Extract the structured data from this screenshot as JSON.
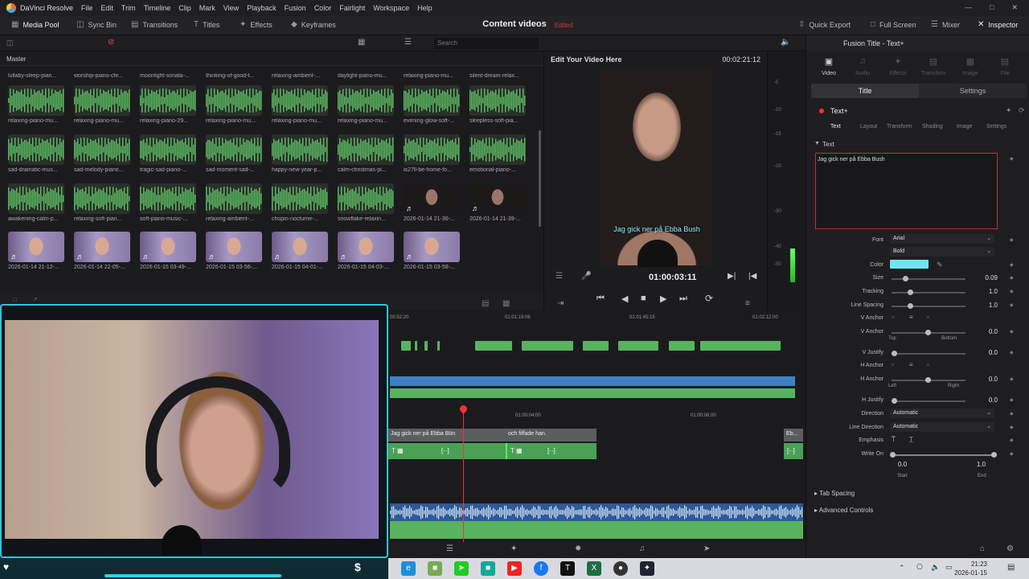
{
  "app": {
    "name": "DaVinci Resolve",
    "menu": [
      "File",
      "Edit",
      "Trim",
      "Timeline",
      "Clip",
      "Mark",
      "View",
      "Playback",
      "Fusion",
      "Color",
      "Fairlight",
      "Workspace",
      "Help"
    ]
  },
  "toolbar": {
    "media_pool": "Media Pool",
    "sync_bin": "Sync Bin",
    "transitions": "Transitions",
    "titles": "Titles",
    "effects": "Effects",
    "keyframes": "Keyframes",
    "project_title": "Content videos",
    "project_status": "Edited",
    "quick_export": "Quick Export",
    "full_screen": "Full Screen",
    "mixer": "Mixer",
    "inspector": "Inspector"
  },
  "search": {
    "placeholder": "Search"
  },
  "media_pool": {
    "bin": "Master",
    "top_labels": [
      "lullaby-sleep-pian...",
      "worship-piano-chr...",
      "moonlight-sonata-...",
      "thinking-of-good-t...",
      "relaxing-ambient-...",
      "daylight-piano-mu...",
      "relaxing-piano-mu...",
      "silent-dream-relax..."
    ],
    "rows": [
      [
        {
          "label": "relaxing-piano-mu...",
          "kind": "audio"
        },
        {
          "label": "relaxing-piano-mu...",
          "kind": "audio"
        },
        {
          "label": "relaxing-piano-29...",
          "kind": "audio"
        },
        {
          "label": "relaxing-piano-mu...",
          "kind": "audio"
        },
        {
          "label": "relaxing-piano-mu...",
          "kind": "audio"
        },
        {
          "label": "relaxing-piano-mu...",
          "kind": "audio"
        },
        {
          "label": "evening-glow-soft-...",
          "kind": "audio"
        },
        {
          "label": "sleepless-soft-pia...",
          "kind": "audio"
        }
      ],
      [
        {
          "label": "sad-dramatic-mus...",
          "kind": "audio"
        },
        {
          "label": "sad-melody-piano...",
          "kind": "audio"
        },
        {
          "label": "tragic-sad-piano-...",
          "kind": "audio"
        },
        {
          "label": "sad-moment-sad-...",
          "kind": "audio"
        },
        {
          "label": "happy-new-year-p...",
          "kind": "audio"
        },
        {
          "label": "calm-christmas-pi...",
          "kind": "audio"
        },
        {
          "label": "ix27ll-be-home-fo...",
          "kind": "audio"
        },
        {
          "label": "emotional-piano-...",
          "kind": "audio"
        }
      ],
      [
        {
          "label": "awakening-calm-p...",
          "kind": "audio"
        },
        {
          "label": "relaxing-soft-pian...",
          "kind": "audio"
        },
        {
          "label": "soft-piano-music-...",
          "kind": "audio"
        },
        {
          "label": "relaxing-ambient-...",
          "kind": "audio"
        },
        {
          "label": "chopin-nocturne-...",
          "kind": "audio"
        },
        {
          "label": "snowflake-relaxin...",
          "kind": "audio"
        },
        {
          "label": "2026-01-14 21-36-...",
          "kind": "dark"
        },
        {
          "label": "2026-01-14 21-39-...",
          "kind": "dark"
        }
      ],
      [
        {
          "label": "2026-01-14 21-12-...",
          "kind": "face"
        },
        {
          "label": "2026-01-14 22-05-...",
          "kind": "face"
        },
        {
          "label": "2026-01-15 03-49-...",
          "kind": "face"
        },
        {
          "label": "2026-01-15 03-56-...",
          "kind": "face"
        },
        {
          "label": "2026-01-15 04-01-...",
          "kind": "face"
        },
        {
          "label": "2026-01-15 04-03-...",
          "kind": "face"
        },
        {
          "label": "2026-01-15 03-58-...",
          "kind": "face"
        }
      ]
    ]
  },
  "viewer": {
    "title": "Edit Your Video Here",
    "duration": "00:02:21:12",
    "timecode": "01:00:03:11",
    "subtitle": "Jag gick ner på Ebba Bush"
  },
  "meters": {
    "ticks": [
      "-5",
      "-10",
      "-15",
      "-20",
      "-30",
      "-40",
      "-50"
    ]
  },
  "inspector": {
    "header": "Fusion Title - Text+",
    "tabs": [
      "Video",
      "Audio",
      "Effects",
      "Transition",
      "Image",
      "File"
    ],
    "title_tab": "Title",
    "settings_tab": "Settings",
    "node": "Text+",
    "subtabs": [
      "Text",
      "Layout",
      "Transform",
      "Shading",
      "Image",
      "Settings"
    ],
    "section": "Text",
    "styled_text": "Jag gick ner på Ebba Bush",
    "font": "Arial",
    "style": "Bold",
    "color_label": "Color",
    "font_label": "Font",
    "size": {
      "label": "Size",
      "value": "0.09"
    },
    "tracking": {
      "label": "Tracking",
      "value": "1.0"
    },
    "line_spacing": {
      "label": "Line Spacing",
      "value": "1.0"
    },
    "v_anchor_label": "V Anchor",
    "v_anchor": {
      "label": "V Anchor",
      "value": "0.0",
      "left": "Top",
      "right": "Bottom"
    },
    "v_justify": {
      "label": "V Justify",
      "value": "0.0"
    },
    "h_anchor_label": "H Anchor",
    "h_anchor": {
      "label": "H Anchor",
      "value": "0.0",
      "left": "Left",
      "right": "Right"
    },
    "h_justify": {
      "label": "H Justify",
      "value": "0.0"
    },
    "direction": {
      "label": "Direction",
      "value": "Automatic"
    },
    "line_direction": {
      "label": "Line Direction",
      "value": "Automatic"
    },
    "emphasis_label": "Emphasis",
    "write_on": {
      "label": "Write On",
      "start": "0.0",
      "end": "1.0",
      "start_label": "Start",
      "end_label": "End"
    },
    "tab_spacing": "Tab Spacing",
    "advanced": "Advanced Controls"
  },
  "timeline": {
    "ruler_top": [
      "00:52:20",
      "01:01:19:06",
      "01:01:45:15",
      "01:02:12:00"
    ],
    "ruler_bottom": [
      "01:00:04:00",
      "01:00:06:00"
    ],
    "subtitle_clips": [
      "Jag gick ner på Ebba Bön",
      "och fiffade han.",
      "Eb..."
    ]
  },
  "taskbar": {
    "time": "21:23",
    "date": "2026-01-15"
  },
  "colors": {
    "accent": "#29c7e3",
    "clip_green": "#58b35f",
    "playhead": "#e33333",
    "text_color": "#6de6f4"
  }
}
